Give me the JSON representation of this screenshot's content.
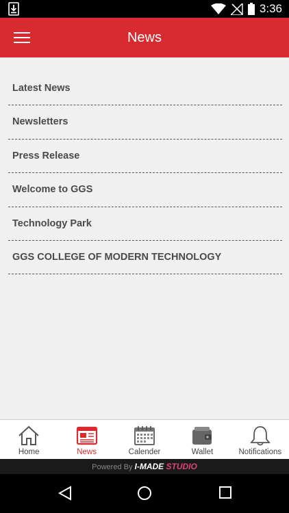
{
  "status_bar": {
    "time": "3:36"
  },
  "app_bar": {
    "title": "News"
  },
  "news_list": [
    {
      "label": "Latest News"
    },
    {
      "label": "Newsletters"
    },
    {
      "label": "Press Release"
    },
    {
      "label": "Welcome to GGS"
    },
    {
      "label": "Technology Park"
    },
    {
      "label": "GGS COLLEGE OF MODERN TECHNOLOGY"
    }
  ],
  "bottom_nav": [
    {
      "label": "Home",
      "icon": "home-icon"
    },
    {
      "label": "News",
      "icon": "newspaper-icon",
      "active": true
    },
    {
      "label": "Calender",
      "icon": "calendar-icon"
    },
    {
      "label": "Wallet",
      "icon": "wallet-icon"
    },
    {
      "label": "Notifications",
      "icon": "bell-icon"
    }
  ],
  "footer": {
    "powered_prefix": "Powered By ",
    "brand_main": "I-MADE ",
    "brand_accent": "STUDIO"
  },
  "colors": {
    "accent": "#d92b2f",
    "brand_pink": "#e0427c"
  }
}
